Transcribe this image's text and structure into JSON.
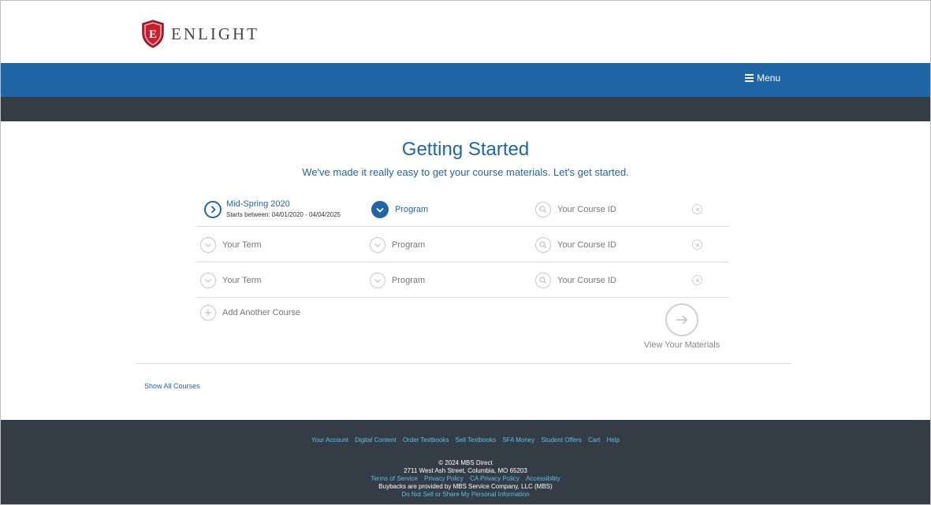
{
  "brand": {
    "name": "ENLIGHT",
    "letter": "E"
  },
  "header": {
    "menu_label": "Menu"
  },
  "main": {
    "title": "Getting Started",
    "subtitle": "We've made it really easy to get your course materials. Let's get started."
  },
  "rows": [
    {
      "term_label": "Mid-Spring 2020",
      "term_dates": "Starts between: 04/01/2020 - 04/04/2025",
      "program_label": "Program",
      "course_id_label": "Your Course ID"
    },
    {
      "term_label": "Your Term",
      "program_label": "Program",
      "course_id_label": "Your Course ID"
    },
    {
      "term_label": "Your Term",
      "program_label": "Program",
      "course_id_label": "Your Course ID"
    }
  ],
  "add_course_label": "Add Another Course",
  "view_materials_label": "View Your Materials",
  "show_all_label": "Show All Courses",
  "footer": {
    "nav": [
      "Your Account",
      "Digital Content",
      "Order Textbooks",
      "Sell Textbooks",
      "SFA Money",
      "Student Offers",
      "Cart",
      "Help"
    ],
    "copyright": "© 2024 MBS Direct",
    "address": "2711 West Ash Street, Columbia, MO 65203",
    "legal_links": [
      "Terms of Service",
      "Privacy Policy",
      "CA Privacy Policy",
      "Accessibility"
    ],
    "buybacks": "Buybacks are provided by MBS Service Company, LLC (MBS)",
    "do_not_sell": "Do Not Sell or Share My Personal Information"
  },
  "colors": {
    "primary_blue": "#1f66a6",
    "dark_bar": "#343d45",
    "link_cyan": "#5cc1e8",
    "brand_red": "#c8202f"
  }
}
